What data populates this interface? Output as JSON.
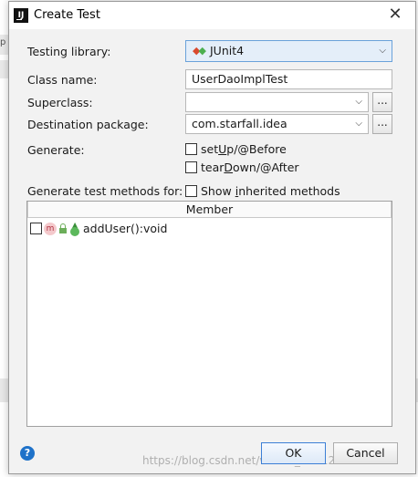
{
  "window": {
    "title": "Create Test"
  },
  "form": {
    "testing_library_label": "Testing library:",
    "testing_library_value": "JUnit4",
    "class_name_label": "Class name:",
    "class_name_value": "UserDaoImplTest",
    "superclass_label": "Superclass:",
    "superclass_value": "",
    "destination_label": "Destination package:",
    "destination_value": "com.starfall.idea",
    "browse_label": "...",
    "generate_label": "Generate:",
    "setup_pre": "set",
    "setup_ul": "U",
    "setup_post": "p/@Before",
    "teardown_pre": "tear",
    "teardown_ul": "D",
    "teardown_post": "own/@After",
    "gen_methods_label": "Generate test methods for:",
    "inherited_pre": "Show ",
    "inherited_ul": "i",
    "inherited_post": "nherited methods"
  },
  "table": {
    "header": "Member",
    "rows": [
      {
        "icon": "m",
        "label": "addUser():void"
      }
    ]
  },
  "buttons": {
    "ok": "OK",
    "cancel": "Cancel",
    "help": "?"
  },
  "watermark": "https://blog.csdn.net/weixin_43612138",
  "colors": {
    "accent": "#3c7fd6",
    "dialog_bg": "#f2f2f2",
    "help_icon": "#1f72c9"
  }
}
